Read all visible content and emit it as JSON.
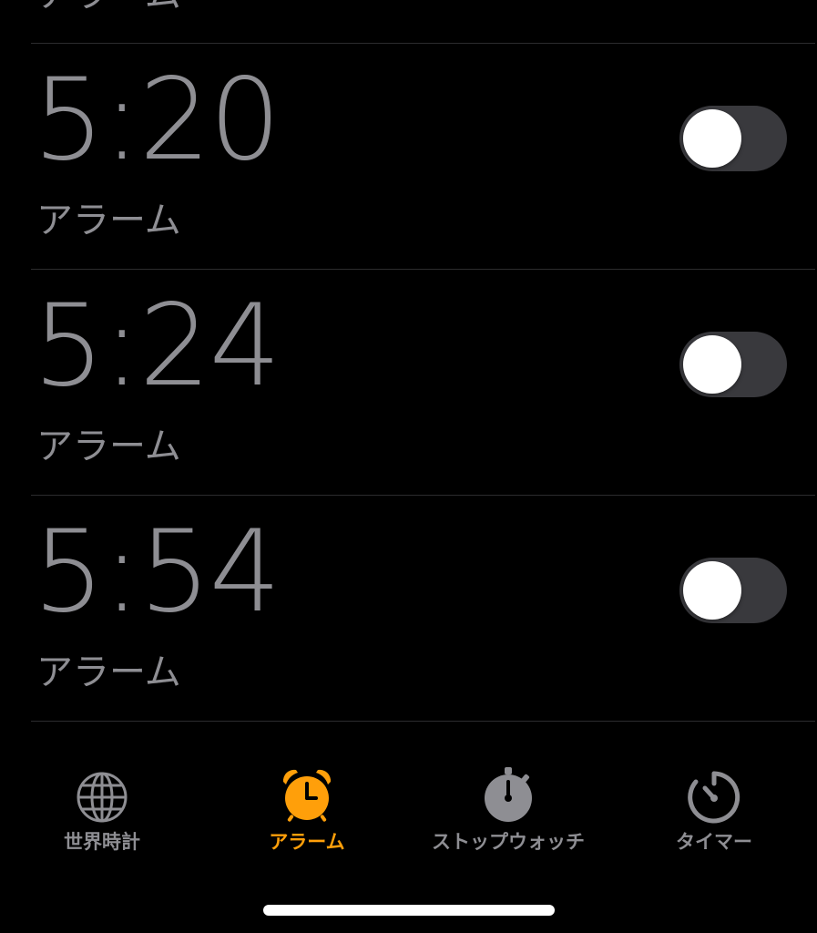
{
  "alarms": {
    "partial_top": {
      "label": "アラーム"
    },
    "items": [
      {
        "time": "5:20",
        "label": "アラーム",
        "enabled": false
      },
      {
        "time": "5:24",
        "label": "アラーム",
        "enabled": false
      },
      {
        "time": "5:54",
        "label": "アラーム",
        "enabled": false
      }
    ]
  },
  "tab_bar": {
    "tabs": [
      {
        "label": "世界時計",
        "icon": "globe-icon",
        "active": false
      },
      {
        "label": "アラーム",
        "icon": "alarm-clock-icon",
        "active": true
      },
      {
        "label": "ストップウォッチ",
        "icon": "stopwatch-icon",
        "active": false
      },
      {
        "label": "タイマー",
        "icon": "timer-icon",
        "active": false
      }
    ]
  },
  "colors": {
    "background": "#000000",
    "text_inactive": "#8e8e93",
    "accent": "#ff9f0a",
    "toggle_off": "#39393d",
    "divider": "#2c2c2e"
  }
}
